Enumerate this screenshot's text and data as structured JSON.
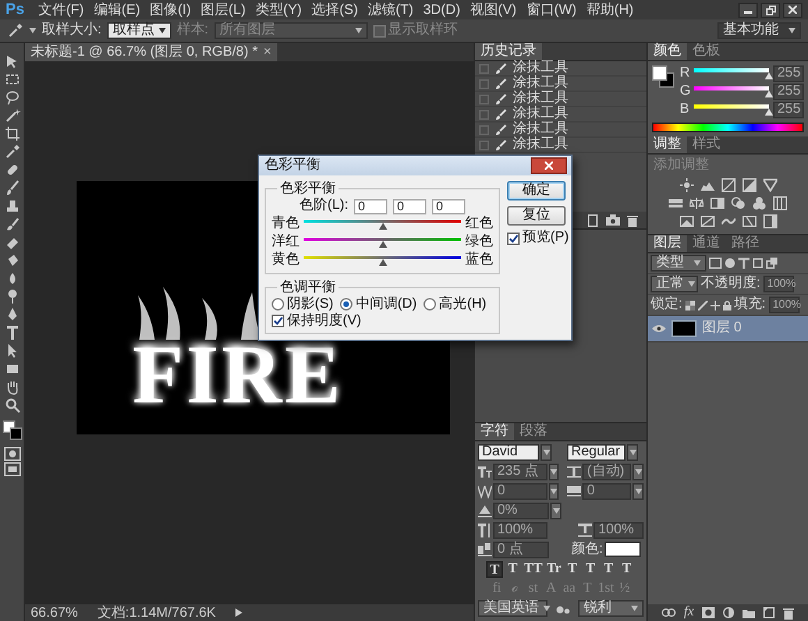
{
  "app": {
    "logo": "Ps"
  },
  "menu": [
    "文件(F)",
    "编辑(E)",
    "图像(I)",
    "图层(L)",
    "类型(Y)",
    "选择(S)",
    "滤镜(T)",
    "3D(D)",
    "视图(V)",
    "窗口(W)",
    "帮助(H)"
  ],
  "options": {
    "sample_size_label": "取样大小:",
    "sample_size": "取样点",
    "sample_label": "样本:",
    "sample": "所有图层",
    "show_ring": {
      "label": "显示取样环",
      "checked": false
    },
    "workspace": "基本功能"
  },
  "document_tab": {
    "title": "未标题-1 @ 66.7% (图层 0, RGB/8) *",
    "close": "×"
  },
  "canvas": {
    "text": "FIRE"
  },
  "status_bar": {
    "zoom": "66.67%",
    "doc_info": "文档:1.14M/767.6K"
  },
  "history": {
    "tab": "历史记录",
    "items": [
      {
        "label": "涂抹工具"
      },
      {
        "label": "涂抹工具"
      },
      {
        "label": "涂抹工具"
      },
      {
        "label": "涂抹工具"
      },
      {
        "label": "涂抹工具"
      },
      {
        "label": "涂抹工具"
      }
    ]
  },
  "color_panel": {
    "tabs": [
      {
        "label": "颜色",
        "selected": true
      },
      {
        "label": "色板",
        "selected": false
      }
    ],
    "channels": [
      {
        "name": "R",
        "value": "255",
        "level": 1
      },
      {
        "name": "G",
        "value": "255",
        "level": 1
      },
      {
        "name": "B",
        "value": "255",
        "level": 1
      }
    ]
  },
  "adjustments": {
    "tabs": [
      {
        "label": "调整",
        "selected": true
      },
      {
        "label": "样式",
        "selected": false
      }
    ],
    "hint": "添加调整"
  },
  "layers": {
    "tabs": [
      {
        "label": "图层",
        "selected": true
      },
      {
        "label": "通道",
        "selected": false
      },
      {
        "label": "路径",
        "selected": false
      }
    ],
    "filter": "类型",
    "blend_mode": "正常",
    "opacity_label": "不透明度:",
    "opacity": "100%",
    "lock_label": "锁定:",
    "fill_label": "填充:",
    "fill": "100%",
    "items": [
      {
        "name": "图层 0",
        "visible": true,
        "selected": true
      }
    ],
    "effects_button": "fx"
  },
  "character": {
    "tabs": [
      {
        "label": "字符",
        "selected": true
      },
      {
        "label": "段落",
        "selected": false
      }
    ],
    "font": "David",
    "style": "Regular",
    "size": "235 点",
    "leading": "(自动)",
    "kerning": "0",
    "tracking": "0",
    "tsume": "0%",
    "vertical_scale": "100%",
    "horizontal_scale": "100%",
    "baseline_shift": "0 点",
    "color_label": "颜色:",
    "style_buttons": [
      {
        "label": "T",
        "selected": true
      },
      {
        "label": "T",
        "selected": false
      },
      {
        "label": "TT",
        "selected": false
      },
      {
        "label": "Tr",
        "selected": false
      },
      {
        "label": "T",
        "selected": false
      },
      {
        "label": "T",
        "selected": false
      },
      {
        "label": "T",
        "selected": false
      },
      {
        "label": "T",
        "selected": false
      }
    ],
    "opentype_buttons": [
      "fi",
      "ℴ",
      "st",
      "A",
      "aa",
      "T",
      "1st",
      "½"
    ],
    "language": "美国英语",
    "antialias": "锐利"
  },
  "dialog": {
    "title": "色彩平衡",
    "balance_group": "色彩平衡",
    "levels_label": "色阶(L):",
    "levels": [
      "0",
      "0",
      "0"
    ],
    "sliders": [
      {
        "left": "青色",
        "right": "红色",
        "level": 0.5
      },
      {
        "left": "洋红",
        "right": "绿色",
        "level": 0.5
      },
      {
        "left": "黄色",
        "right": "蓝色",
        "level": 0.5
      }
    ],
    "tone_group": "色调平衡",
    "tones": [
      {
        "label": "阴影(S)",
        "selected": false
      },
      {
        "label": "中间调(D)",
        "selected": true
      },
      {
        "label": "高光(H)",
        "selected": false
      }
    ],
    "preserve": {
      "label": "保持明度(V)",
      "checked": true
    },
    "buttons": [
      {
        "label": "确定",
        "default": true
      },
      {
        "label": "复位",
        "default": false
      }
    ],
    "preview": {
      "label": "预览(P)",
      "checked": true
    }
  }
}
